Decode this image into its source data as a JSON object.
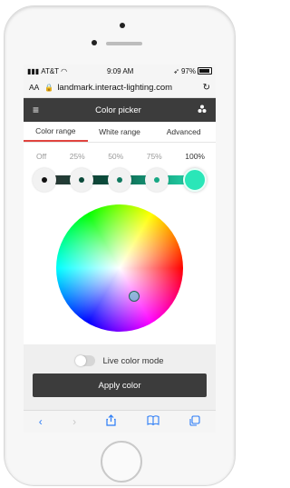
{
  "status": {
    "carrier": "AT&T",
    "time": "9:09 AM",
    "battery": "97%"
  },
  "browser": {
    "text_size_label": "AA",
    "url": "landmark.interact-lighting.com"
  },
  "app": {
    "title": "Color picker"
  },
  "tabs": [
    {
      "label": "Color range",
      "active": true
    },
    {
      "label": "White range",
      "active": false
    },
    {
      "label": "Advanced",
      "active": false
    }
  ],
  "levels": [
    "Off",
    "25%",
    "50%",
    "75%",
    "100%"
  ],
  "selected_level": "100%",
  "slider_stop_colors": [
    "#111111",
    "#0b4a3a",
    "#117a60",
    "#17a784",
    "#2ae6b8"
  ],
  "live_mode": {
    "label": "Live color mode",
    "on": false
  },
  "apply_label": "Apply color",
  "icons": {
    "menu": "hamburger-icon",
    "lights": "lights-icon",
    "lock": "lock-icon",
    "reload": "reload-icon",
    "back": "back-icon",
    "forward": "forward-icon",
    "share": "share-icon",
    "bookmarks": "bookmarks-icon",
    "tabs": "tabs-icon"
  }
}
